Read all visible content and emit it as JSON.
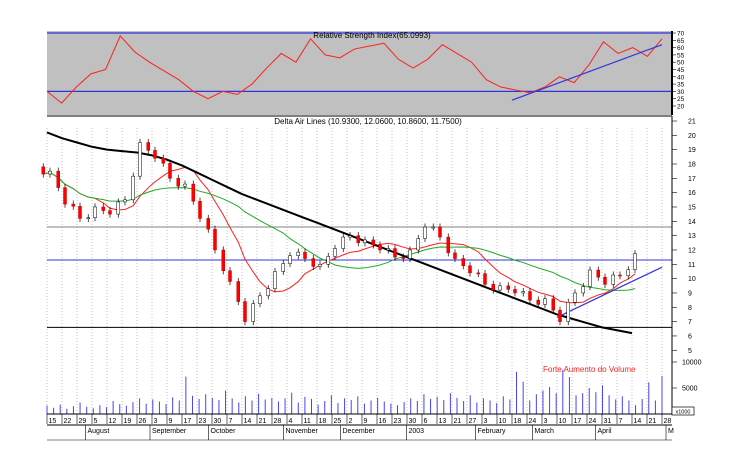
{
  "chart_data": {
    "type": "candlestick",
    "title": "Delta Air Lines (10.9300, 12.0600, 10.8600, 11.7500)",
    "week_labels": [
      "15",
      "22",
      "29",
      "5",
      "12",
      "19",
      "26",
      "3",
      "9",
      "17",
      "23",
      "30",
      "7",
      "14",
      "21",
      "28",
      "4",
      "11",
      "18",
      "25",
      "2",
      "9",
      "16",
      "23",
      "30",
      "6",
      "13",
      "21",
      "27",
      "3",
      "10",
      "18",
      "24",
      "3",
      "10",
      "17",
      "24",
      "31",
      "7",
      "14",
      "21",
      "28"
    ],
    "months": [
      {
        "label": "August",
        "at_week": 2.7
      },
      {
        "label": "September",
        "at_week": 7
      },
      {
        "label": "October",
        "at_week": 10.9
      },
      {
        "label": "November",
        "at_week": 15.9
      },
      {
        "label": "December",
        "at_week": 19.7
      },
      {
        "label": "2003",
        "at_week": 24.1
      },
      {
        "label": "February",
        "at_week": 28.7
      },
      {
        "label": "March",
        "at_week": 32.5
      },
      {
        "label": "April",
        "at_week": 36.7
      },
      {
        "label": "M",
        "at_week": 41.4
      }
    ],
    "price": {
      "ylim": [
        4.6,
        21.2
      ],
      "ticks": [
        21,
        20,
        19,
        18,
        17,
        16,
        15,
        14,
        13,
        12,
        11,
        10,
        9,
        8,
        7,
        6,
        5
      ],
      "weekly_close": [
        17.5,
        15.2,
        14.2,
        15.0,
        14.5,
        15.5,
        19.5,
        18.4,
        17.0,
        16.6,
        14.2,
        12.0,
        9.8,
        7.0,
        8.8,
        10.5,
        11.6,
        11.4,
        11.0,
        12.1,
        13.0,
        12.7,
        12.0,
        11.5,
        12.0,
        13.6,
        12.9,
        11.4,
        10.4,
        9.6,
        9.5,
        9.0,
        8.5,
        8.6,
        7.0,
        9.0,
        10.6,
        9.6,
        10.2,
        11.75
      ],
      "long_trend": [
        20.2,
        19.8,
        19.5,
        19.2,
        19.0,
        18.9,
        18.8,
        18.6,
        18.3,
        17.9,
        17.4,
        16.9,
        16.4,
        15.9,
        15.5,
        15.1,
        14.7,
        14.3,
        13.9,
        13.5,
        13.1,
        12.7,
        12.3,
        11.9,
        11.5,
        11.1,
        10.7,
        10.3,
        9.9,
        9.5,
        9.1,
        8.7,
        8.3,
        7.9,
        7.5,
        7.2,
        6.9,
        6.6,
        6.4,
        6.2
      ],
      "short_ma_period": 4,
      "long_ma_period": 10,
      "horizontal_lines": [
        {
          "value": 13.6,
          "color": "#808080"
        },
        {
          "value": 11.3,
          "color": "#3333dd"
        },
        {
          "value": 6.6,
          "color": "#000000"
        }
      ],
      "trendline": {
        "from": {
          "week": 34,
          "value": 7.3
        },
        "to": {
          "week": 41,
          "value": 10.8
        },
        "color": "#3333dd"
      }
    },
    "rsi": {
      "title": "Relative Strength Index(65.0993)",
      "ylim": [
        15,
        72
      ],
      "ticks": [
        70,
        65,
        60,
        55,
        50,
        45,
        40,
        35,
        30,
        25,
        20
      ],
      "levels": [
        70,
        30
      ],
      "values": [
        30,
        22,
        33,
        42,
        45,
        68,
        57,
        50,
        44,
        38,
        30,
        25,
        30,
        28,
        35,
        46,
        56,
        50,
        66,
        55,
        53,
        59,
        61,
        63,
        52,
        46,
        52,
        62,
        56,
        50,
        38,
        33,
        31,
        29,
        33,
        40,
        36,
        48,
        64,
        56,
        60,
        54,
        66
      ],
      "trendline": {
        "from": {
          "week": 31,
          "value": 24
        },
        "to": {
          "week": 41,
          "value": 62
        }
      }
    },
    "volume": {
      "unit": "x1000",
      "ticks": [
        10000,
        5000
      ],
      "values": [
        1.6,
        1.2,
        1.8,
        1.0,
        1.5,
        2.2,
        1.4,
        1.1,
        1.7,
        1.3,
        2.5,
        1.9,
        1.6,
        2.3,
        3.0,
        2.0,
        2.8,
        2.4,
        1.9,
        3.2,
        2.6,
        7.2,
        3.5,
        2.9,
        3.8,
        3.1,
        2.7,
        4.5,
        3.0,
        2.2,
        3.4,
        2.6,
        3.9,
        2.8,
        3.1,
        2.4,
        3.0,
        4.1,
        2.2,
        3.3,
        2.9,
        1.8,
        2.5,
        3.6,
        2.1,
        3.0,
        2.7,
        3.4,
        2.0,
        2.6,
        3.1,
        2.4,
        2.0,
        1.7,
        2.3,
        3.0,
        2.5,
        3.8,
        2.9,
        3.3,
        2.7,
        4.0,
        3.1,
        2.5,
        3.6,
        2.2,
        3.0,
        2.6,
        2.1,
        3.4,
        2.8,
        8.1,
        6.2,
        2.6,
        3.8,
        4.5,
        5.2,
        4.0,
        8.5,
        7.1,
        3.6,
        4.0,
        5.0,
        4.2,
        5.5,
        3.6,
        2.8,
        3.4,
        2.6,
        1.7,
        2.9,
        6.1,
        2.6,
        7.3
      ]
    },
    "annotation": {
      "text": "Forte Aumento do Volume",
      "color": "#ff2222"
    }
  }
}
